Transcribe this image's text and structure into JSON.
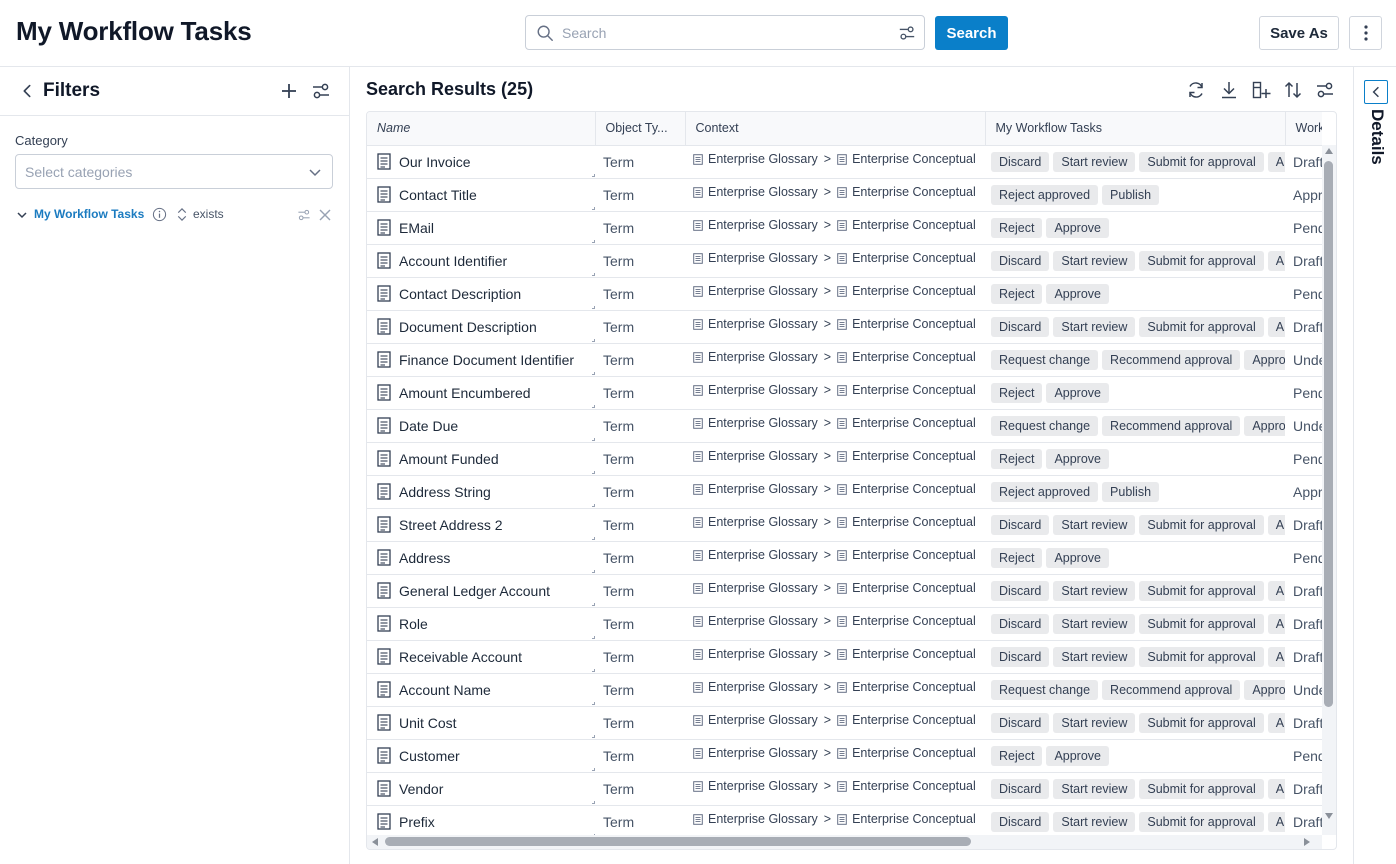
{
  "header": {
    "title": "My Workflow Tasks",
    "search_placeholder": "Search",
    "search_button": "Search",
    "save_as_button": "Save As"
  },
  "filters": {
    "title": "Filters",
    "category_label": "Category",
    "category_placeholder": "Select categories",
    "active_filter": {
      "name": "My Workflow Tasks",
      "operator": "exists"
    }
  },
  "results": {
    "title": "Search Results (25)",
    "columns": [
      "Name",
      "Object Ty...",
      "Context",
      "My Workflow Tasks",
      "Workflo"
    ],
    "context_parts": {
      "first": "Enterprise Glossary",
      "separator": ">",
      "second": "Enterprise Conceptual"
    },
    "rows": [
      {
        "name": "Our Invoice",
        "type": "Term",
        "tasks": [
          "Discard",
          "Start review",
          "Submit for approval",
          "A"
        ],
        "state": "Draft"
      },
      {
        "name": "Contact Title",
        "type": "Term",
        "tasks": [
          "Reject approved",
          "Publish"
        ],
        "state": "Approved"
      },
      {
        "name": "EMail",
        "type": "Term",
        "tasks": [
          "Reject",
          "Approve"
        ],
        "state": "Pending"
      },
      {
        "name": "Account Identifier",
        "type": "Term",
        "tasks": [
          "Discard",
          "Start review",
          "Submit for approval",
          "A"
        ],
        "state": "Draft"
      },
      {
        "name": "Contact Description",
        "type": "Term",
        "tasks": [
          "Reject",
          "Approve"
        ],
        "state": "Pending"
      },
      {
        "name": "Document Description",
        "type": "Term",
        "tasks": [
          "Discard",
          "Start review",
          "Submit for approval",
          "A"
        ],
        "state": "Draft"
      },
      {
        "name": "Finance Document Identifier",
        "type": "Term",
        "tasks": [
          "Request change",
          "Recommend approval",
          "Approve"
        ],
        "state": "Under review"
      },
      {
        "name": "Amount Encumbered",
        "type": "Term",
        "tasks": [
          "Reject",
          "Approve"
        ],
        "state": "Pending"
      },
      {
        "name": "Date Due",
        "type": "Term",
        "tasks": [
          "Request change",
          "Recommend approval",
          "Approve"
        ],
        "state": "Under review"
      },
      {
        "name": "Amount Funded",
        "type": "Term",
        "tasks": [
          "Reject",
          "Approve"
        ],
        "state": "Pending"
      },
      {
        "name": "Address String",
        "type": "Term",
        "tasks": [
          "Reject approved",
          "Publish"
        ],
        "state": "Approved"
      },
      {
        "name": "Street Address 2",
        "type": "Term",
        "tasks": [
          "Discard",
          "Start review",
          "Submit for approval",
          "A"
        ],
        "state": "Draft"
      },
      {
        "name": "Address",
        "type": "Term",
        "tasks": [
          "Reject",
          "Approve"
        ],
        "state": "Pending"
      },
      {
        "name": "General Ledger Account",
        "type": "Term",
        "tasks": [
          "Discard",
          "Start review",
          "Submit for approval",
          "A"
        ],
        "state": "Draft"
      },
      {
        "name": "Role",
        "type": "Term",
        "tasks": [
          "Discard",
          "Start review",
          "Submit for approval",
          "A"
        ],
        "state": "Draft"
      },
      {
        "name": "Receivable Account",
        "type": "Term",
        "tasks": [
          "Discard",
          "Start review",
          "Submit for approval",
          "A"
        ],
        "state": "Draft"
      },
      {
        "name": "Account Name",
        "type": "Term",
        "tasks": [
          "Request change",
          "Recommend approval",
          "Approve"
        ],
        "state": "Under review"
      },
      {
        "name": "Unit Cost",
        "type": "Term",
        "tasks": [
          "Discard",
          "Start review",
          "Submit for approval",
          "A"
        ],
        "state": "Draft"
      },
      {
        "name": "Customer",
        "type": "Term",
        "tasks": [
          "Reject",
          "Approve"
        ],
        "state": "Pending"
      },
      {
        "name": "Vendor",
        "type": "Term",
        "tasks": [
          "Discard",
          "Start review",
          "Submit for approval",
          "A"
        ],
        "state": "Draft"
      },
      {
        "name": "Prefix",
        "type": "Term",
        "tasks": [
          "Discard",
          "Start review",
          "Submit for approval",
          "A"
        ],
        "state": "Draft"
      }
    ]
  },
  "details": {
    "label": "Details"
  },
  "colors": {
    "accent": "#0a7fc9",
    "link": "#1b7bc0",
    "chip_bg": "#e9eaec",
    "border": "#e4e7ec"
  }
}
